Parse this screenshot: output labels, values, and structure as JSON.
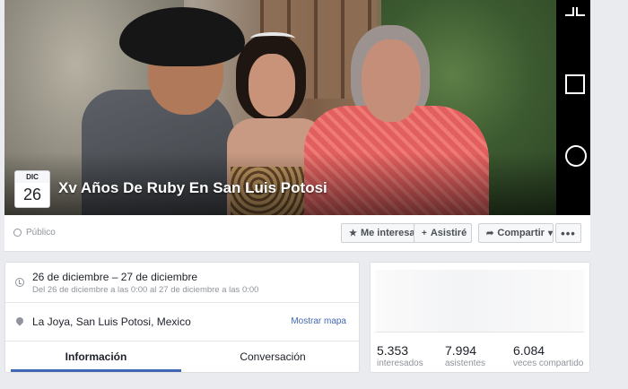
{
  "event": {
    "title": "Xv Años De Ruby En San Luis Potosi",
    "month": "DIC",
    "day": "26"
  },
  "privacy": {
    "label": "Público"
  },
  "actions": {
    "interest_label": "Me interesa",
    "going_label": "Asistiré",
    "share_label": "Compartir",
    "more_label": "•••"
  },
  "details": {
    "date_main": "26 de diciembre – 27 de diciembre",
    "date_sub": "Del 26 de diciembre a las 0:00 al 27 de diciembre a las 0:00",
    "location": "La Joya, San Luis Potosi, Mexico",
    "map_link": "Mostrar mapa"
  },
  "tabs": [
    {
      "label": "Información",
      "active": true
    },
    {
      "label": "Conversación",
      "active": false
    }
  ],
  "stats": [
    {
      "value": "5.353",
      "label": "interesados"
    },
    {
      "value": "7.994",
      "label": "asistentes"
    },
    {
      "value": "6.084",
      "label": "veces compartido"
    }
  ],
  "colors": {
    "link": "#4267b2",
    "background": "#e9ebee"
  },
  "icons": [
    "collapse-icon",
    "square-icon",
    "circle-icon",
    "globe-icon",
    "star-icon",
    "plus-icon",
    "share-icon",
    "caret-down-icon",
    "clock-icon",
    "pin-icon"
  ]
}
